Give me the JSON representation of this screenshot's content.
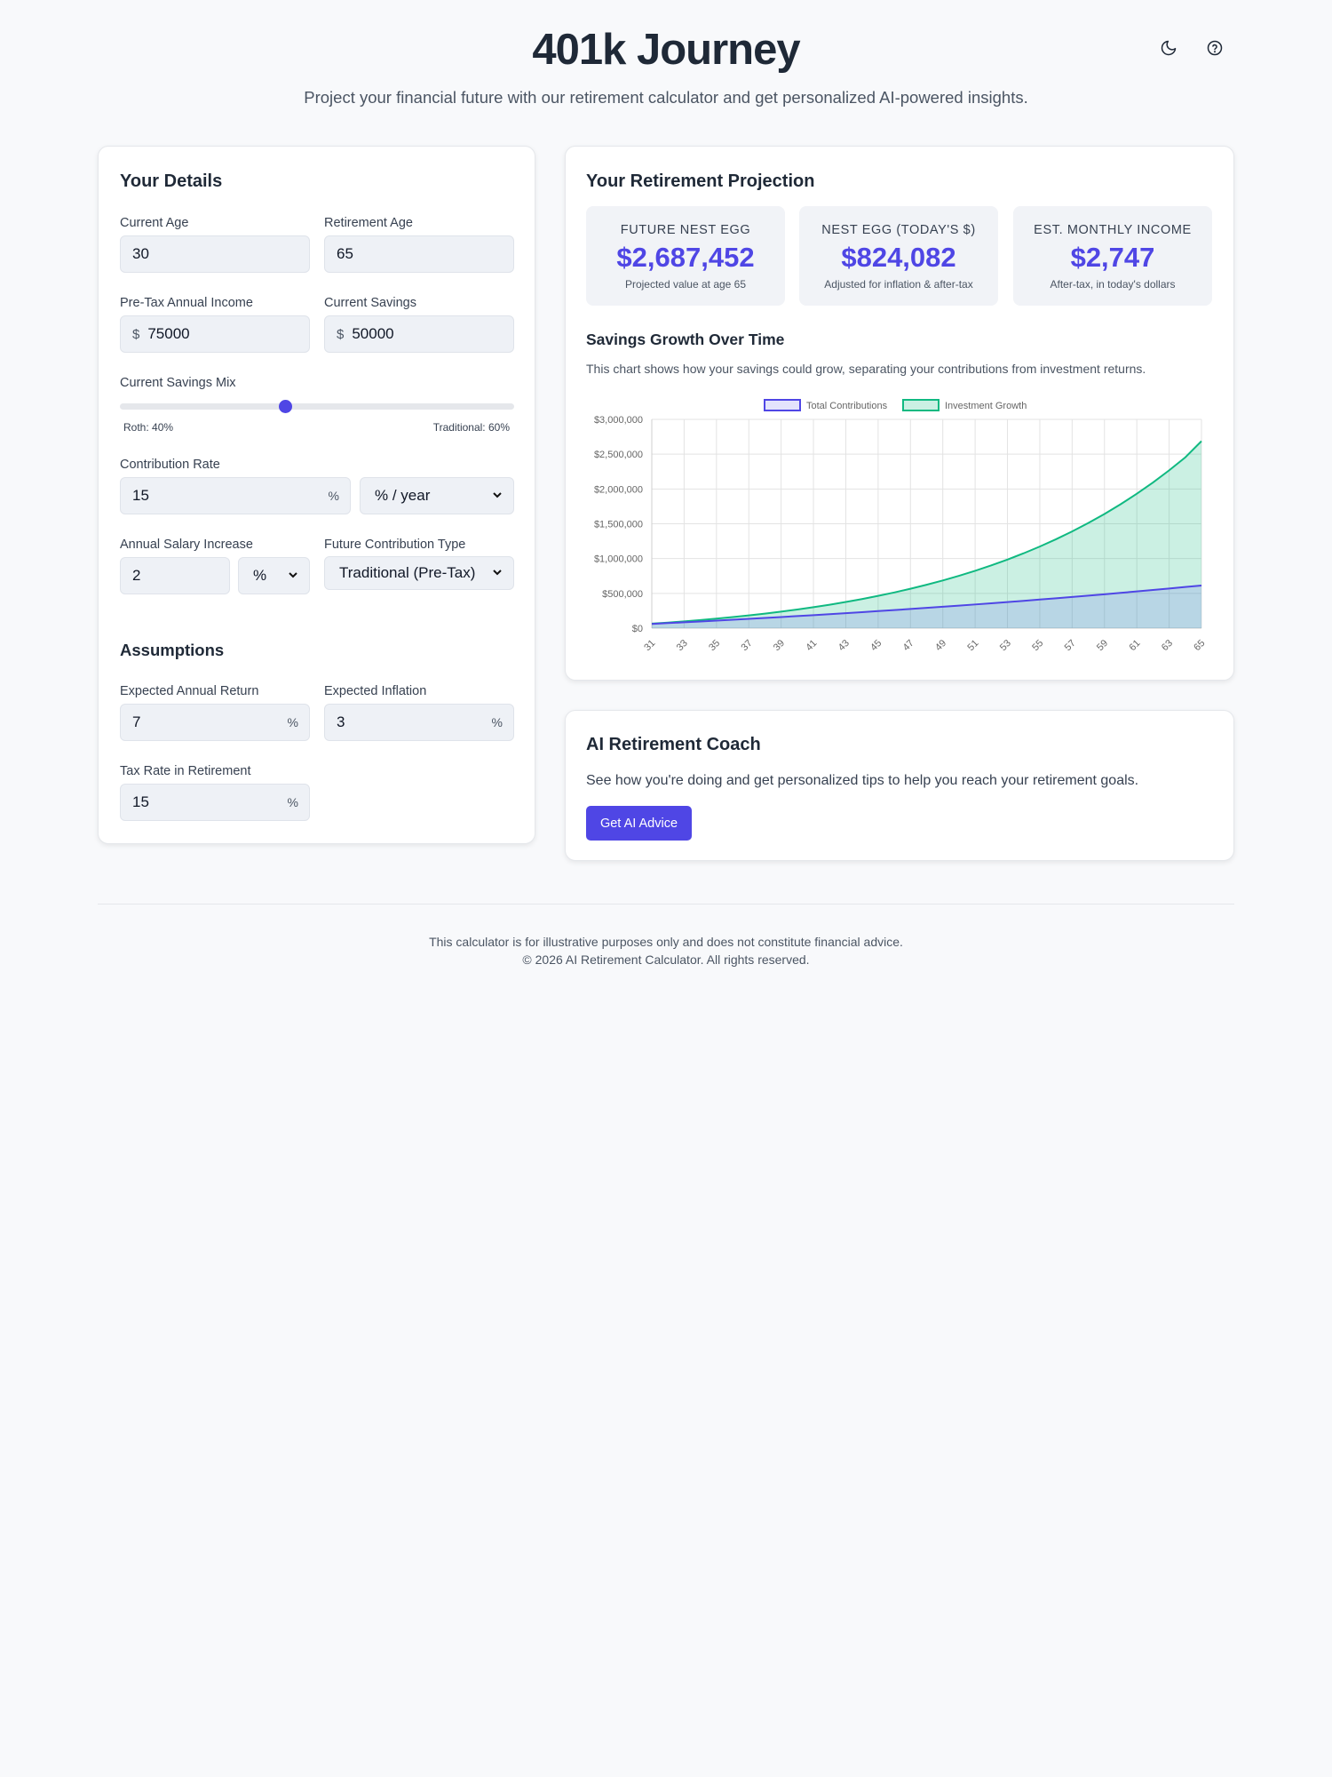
{
  "header": {
    "title": "401k Journey",
    "subtitle": "Project your financial future with our retirement calculator and get personalized AI-powered insights.",
    "theme_icon": "moon-icon",
    "help_icon": "help-circle-icon"
  },
  "details": {
    "title": "Your Details",
    "current_age": {
      "label": "Current Age",
      "value": "30"
    },
    "retirement_age": {
      "label": "Retirement Age",
      "value": "65"
    },
    "income": {
      "label": "Pre-Tax Annual Income",
      "prefix": "$",
      "value": "75000"
    },
    "savings": {
      "label": "Current Savings",
      "prefix": "$",
      "value": "50000"
    },
    "mix": {
      "label": "Current Savings Mix",
      "roth_label": "Roth: 40%",
      "traditional_label": "Traditional: 60%",
      "roth_percent": 40
    },
    "contribution": {
      "label": "Contribution Rate",
      "value": "15",
      "suffix": "%",
      "unit_selected": "% / year"
    },
    "salary_increase": {
      "label": "Annual Salary Increase",
      "value": "2",
      "unit_selected": "%"
    },
    "future_type": {
      "label": "Future Contribution Type",
      "selected": "Traditional (Pre-Tax)"
    }
  },
  "assumptions": {
    "title": "Assumptions",
    "return": {
      "label": "Expected Annual Return",
      "value": "7",
      "suffix": "%"
    },
    "inflation": {
      "label": "Expected Inflation",
      "value": "3",
      "suffix": "%"
    },
    "tax": {
      "label": "Tax Rate in Retirement",
      "value": "15",
      "suffix": "%"
    }
  },
  "projection": {
    "title": "Your Retirement Projection",
    "stats": [
      {
        "label": "FUTURE NEST EGG",
        "value": "$2,687,452",
        "note": "Projected value at age 65"
      },
      {
        "label": "NEST EGG (TODAY'S $)",
        "value": "$824,082",
        "note": "Adjusted for inflation & after-tax"
      },
      {
        "label": "EST. MONTHLY INCOME",
        "value": "$2,747",
        "note": "After-tax, in today's dollars"
      }
    ],
    "chart_title": "Savings Growth Over Time",
    "chart_desc": "This chart shows how your savings could grow, separating your contributions from investment returns."
  },
  "chart_data": {
    "type": "area",
    "x": [
      31,
      32,
      33,
      34,
      35,
      36,
      37,
      38,
      39,
      40,
      41,
      42,
      43,
      44,
      45,
      46,
      47,
      48,
      49,
      50,
      51,
      52,
      53,
      54,
      55,
      56,
      57,
      58,
      59,
      60,
      61,
      62,
      63,
      64,
      65
    ],
    "xticks": [
      "31",
      "33",
      "35",
      "37",
      "39",
      "41",
      "43",
      "45",
      "47",
      "49",
      "51",
      "53",
      "55",
      "57",
      "59",
      "61",
      "63",
      "65"
    ],
    "yticks": [
      "$0",
      "$500,000",
      "$1,000,000",
      "$1,500,000",
      "$2,000,000",
      "$2,500,000",
      "$3,000,000"
    ],
    "ylim": [
      0,
      3000000
    ],
    "series": [
      {
        "name": "Total Contributions",
        "color": "#4f46e5",
        "fill": "rgba(99,102,241,0.18)",
        "values": [
          61250,
          72700,
          84400,
          96400,
          108600,
          121100,
          133800,
          146800,
          160000,
          173500,
          187300,
          201300,
          215600,
          230200,
          245000,
          260200,
          275700,
          291500,
          307500,
          324000,
          340700,
          357800,
          375200,
          393000,
          411100,
          429600,
          448500,
          467700,
          487300,
          507300,
          527700,
          548500,
          569800,
          591400,
          613500
        ]
      },
      {
        "name": "Investment Growth",
        "color": "#10b981",
        "fill": "rgba(16,185,129,0.22)",
        "values": [
          64750,
          80500,
          97700,
          116400,
          136700,
          158900,
          182900,
          209000,
          237300,
          268000,
          301300,
          337300,
          376300,
          418500,
          464100,
          513300,
          566500,
          623900,
          685700,
          752500,
          824500,
          902100,
          985700,
          1075700,
          1172700,
          1277100,
          1389600,
          1510500,
          1640800,
          1780800,
          1931400,
          2093400,
          2267700,
          2454600,
          2687452
        ]
      }
    ]
  },
  "coach": {
    "title": "AI Retirement Coach",
    "desc": "See how you're doing and get personalized tips to help you reach your retirement goals.",
    "button": "Get AI Advice"
  },
  "footer": {
    "disclaimer": "This calculator is for illustrative purposes only and does not constitute financial advice.",
    "copyright": "© 2026 AI Retirement Calculator. All rights reserved."
  }
}
